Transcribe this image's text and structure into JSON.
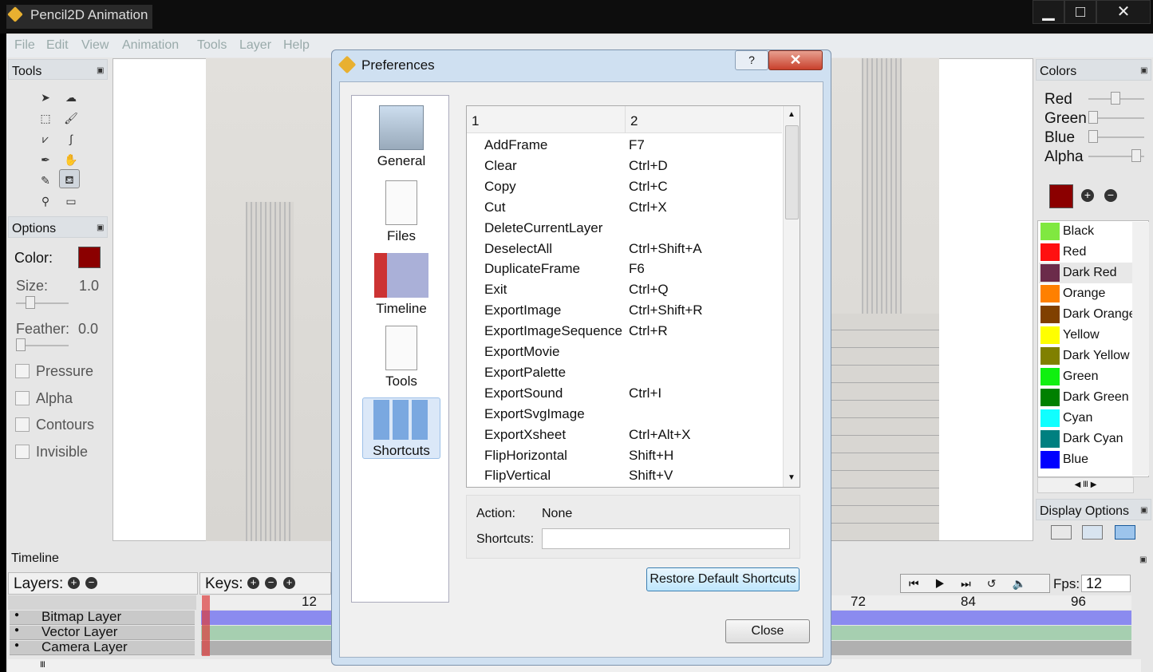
{
  "window": {
    "title": "Pencil2D Animation",
    "minimize": "▁",
    "maximize": "□",
    "close": "✕"
  },
  "menu": [
    "File",
    "Edit",
    "View",
    "Animation",
    "Tools",
    "Layer",
    "Help"
  ],
  "tools_panel": {
    "title": "Tools"
  },
  "options_panel": {
    "title": "Options",
    "color_label": "Color:",
    "color": "#8b0000",
    "size_label": "Size:",
    "size_value": "1.0",
    "feather_label": "Feather:",
    "feather_value": "0.0",
    "checkboxes": [
      "Pressure",
      "Alpha",
      "Contours",
      "Invisible"
    ]
  },
  "colors_panel": {
    "title": "Colors",
    "red_label": "Red",
    "green_label": "Green",
    "blue_label": "Blue",
    "alpha_label": "Alpha",
    "current": "#8b0000",
    "palette": [
      {
        "name": "Black",
        "color": "#80e840"
      },
      {
        "name": "Red",
        "color": "#ff1010"
      },
      {
        "name": "Dark Red",
        "color": "#6b2b4a"
      },
      {
        "name": "Orange",
        "color": "#ff8000"
      },
      {
        "name": "Dark Orange",
        "color": "#804000"
      },
      {
        "name": "Yellow",
        "color": "#ffff00"
      },
      {
        "name": "Dark Yellow",
        "color": "#808000"
      },
      {
        "name": "Green",
        "color": "#10f010"
      },
      {
        "name": "Dark Green",
        "color": "#008000"
      },
      {
        "name": "Cyan",
        "color": "#10ffff"
      },
      {
        "name": "Dark Cyan",
        "color": "#008080"
      },
      {
        "name": "Blue",
        "color": "#0000ff"
      }
    ]
  },
  "display_options": {
    "title": "Display Options"
  },
  "timeline": {
    "title": "Timeline",
    "layers_label": "Layers:",
    "keys_label": "Keys:",
    "fps_label": "Fps:",
    "fps_value": "12",
    "layers": [
      {
        "name": "Bitmap Layer",
        "color": "#8b8bef"
      },
      {
        "name": "Vector Layer",
        "color": "#a6cfb0"
      },
      {
        "name": "Camera Layer",
        "color": "#b0b0b0"
      }
    ],
    "ticks": [
      "12",
      "72",
      "84",
      "96"
    ]
  },
  "dialog": {
    "title": "Preferences",
    "help": "?",
    "close_x": "✕",
    "nav": [
      {
        "label": "General"
      },
      {
        "label": "Files"
      },
      {
        "label": "Timeline"
      },
      {
        "label": "Tools"
      },
      {
        "label": "Shortcuts"
      }
    ],
    "table": {
      "col1": "1",
      "col2": "2",
      "rows": [
        {
          "action": "AddFrame",
          "key": "F7"
        },
        {
          "action": "Clear",
          "key": "Ctrl+D"
        },
        {
          "action": "Copy",
          "key": "Ctrl+C"
        },
        {
          "action": "Cut",
          "key": "Ctrl+X"
        },
        {
          "action": "DeleteCurrentLayer",
          "key": ""
        },
        {
          "action": "DeselectAll",
          "key": "Ctrl+Shift+A"
        },
        {
          "action": "DuplicateFrame",
          "key": "F6"
        },
        {
          "action": "Exit",
          "key": "Ctrl+Q"
        },
        {
          "action": "ExportImage",
          "key": "Ctrl+Shift+R"
        },
        {
          "action": "ExportImageSequence",
          "key": "Ctrl+R"
        },
        {
          "action": "ExportMovie",
          "key": ""
        },
        {
          "action": "ExportPalette",
          "key": ""
        },
        {
          "action": "ExportSound",
          "key": "Ctrl+I"
        },
        {
          "action": "ExportSvgImage",
          "key": ""
        },
        {
          "action": "ExportXsheet",
          "key": "Ctrl+Alt+X"
        },
        {
          "action": "FlipHorizontal",
          "key": "Shift+H"
        },
        {
          "action": "FlipVertical",
          "key": "Shift+V"
        }
      ]
    },
    "action_label": "Action:",
    "action_value": "None",
    "shortcuts_label": "Shortcuts:",
    "shortcuts_value": "",
    "restore_button": "Restore Default Shortcuts",
    "close_button": "Close"
  }
}
